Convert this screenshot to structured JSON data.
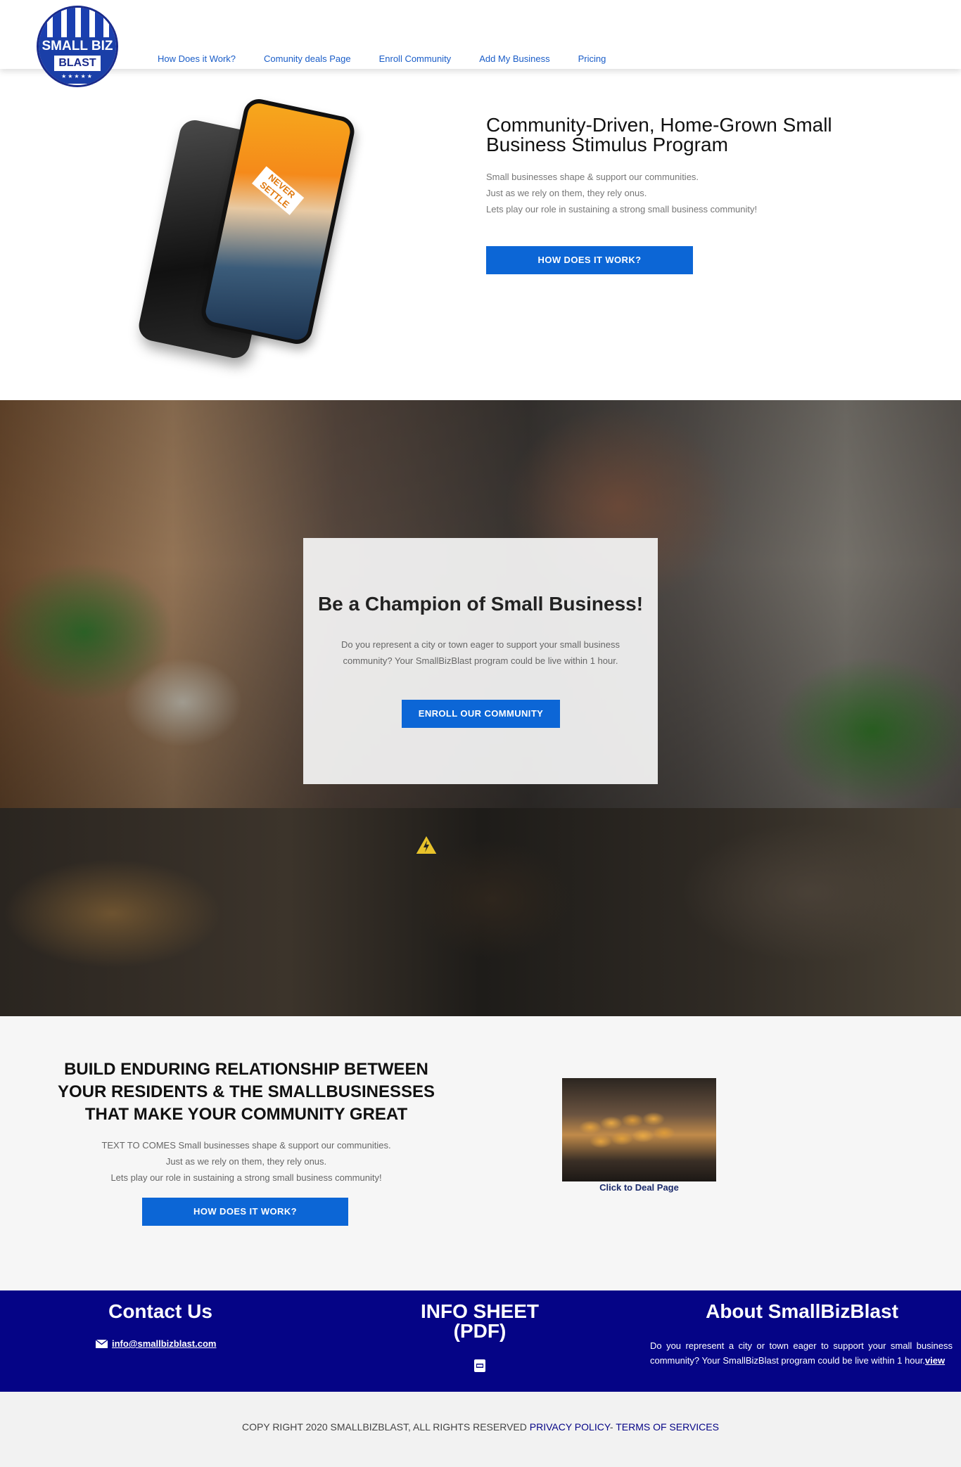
{
  "logo": {
    "line1": "SMALL BIZ",
    "line2": "BLAST",
    "stars": "★★★★★"
  },
  "nav": {
    "items": [
      {
        "label": "How Does it Work?"
      },
      {
        "label": "Comunity deals Page"
      },
      {
        "label": "Enroll Community"
      },
      {
        "label": "Add My Business"
      },
      {
        "label": "Pricing"
      }
    ]
  },
  "hero": {
    "phone_label": "NEVER SETTLE",
    "title": "Community-Driven, Home-Grown Small Business Stimulus Program",
    "text_lines": [
      "Small businesses shape & support our communities.",
      "Just as we rely on them, they rely onus.",
      "Lets play our role in sustaining a strong small business community!"
    ],
    "button": "HOW DOES IT WORK?"
  },
  "champion": {
    "title": "Be a Champion of Small Business!",
    "text": "Do you represent a city or town eager to support your small business community? Your SmallBizBlast program could be live within 1 hour.",
    "button": "ENROLL OUR COMMUNITY"
  },
  "relationship": {
    "title": "BUILD ENDURING RELATIONSHIP BETWEEN YOUR RESIDENTS & THE SMALLBUSINESSES THAT MAKE YOUR COMMUNITY GREAT",
    "text_lines": [
      "TEXT TO COMES Small businesses shape & support our communities.",
      "Just as we rely on them, they rely onus.",
      "Lets play our role in sustaining a strong small business community!"
    ],
    "button": "HOW DOES IT WORK?",
    "deal_caption": "Click to Deal Page"
  },
  "footer": {
    "contact_title": "Contact Us",
    "email": "info@smallbizblast.com",
    "info_title_line1": "INFO SHEET",
    "info_title_line2": "(PDF)",
    "about_title": "About SmallBizBlast",
    "about_text": "Do you represent a city or town eager to support your small business community? Your SmallBizBlast program could be live within 1 hour.",
    "about_link": "view"
  },
  "copyright": {
    "text": "COPY RIGHT 2020 SMALLBIZBLAST, ALL RIGHTS RESERVED ",
    "privacy": "PRIVACY POLICY",
    "separator": "- ",
    "terms": "TERMS OF SERVICES"
  },
  "colors": {
    "primary_button": "#0c66d6",
    "footer_blue": "#050486",
    "nav_link": "#1a5dc8"
  },
  "icons": {
    "email": "envelope-icon",
    "pdf": "pdf-file-icon",
    "warning": "warning-triangle-icon"
  }
}
